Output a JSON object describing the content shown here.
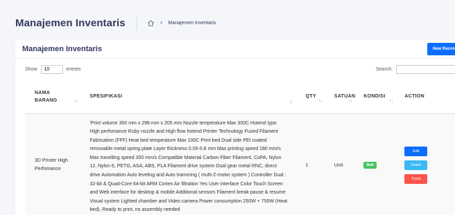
{
  "header": {
    "title": "Manajemen Inventaris",
    "breadcrumb": "Manajemen Inventaris"
  },
  "card": {
    "title": "Manajemen Inventaris",
    "new_button": "New Record"
  },
  "controls": {
    "show_label": "Show",
    "entries_value": "10",
    "entries_label": "entries",
    "search_label": "Search:"
  },
  "table": {
    "columns": [
      "NAMA BARANG",
      "SPESIFIKASI",
      "QTY",
      "SATUAN",
      "KONDISI",
      "ACTION"
    ],
    "sort_icon": "↑↓",
    "rows": [
      {
        "nama": "3D Printer High Perfomance",
        "spesifikasi": "'Print volume 300 mm x 298 mm x 205 mm Nozzle temperature Max 300C Hotend type High perfomance Ruby nozzle and High flow hotend Printer Technology Fused Filament Fabrication (FFF) Heat bed temperature Max 100C Print bed Dual side PEI coated removable metal spring plate Layer thickness 0.05-0.8 mm Max printing speed 180 mm/s Max travelling speed 350 mm/s Compatible Material Carbon Fiber Filament, CoPA, Nylon 12, Nylon 6, PETG, ASA, ABS, PLA Filament drive system Dual gear metal RNC, direct drive Automation Auto leveling and Auto tramming ( multi-Z-motor system ) Controller Dual : 32-bit & Quad-Core 64-bit ARM Cortex Air filtration Yes User interface Color Touch Screen and Web interface for desktop & mobile Additional sensors Filament break pause & resume Visual system Lighted chamber and Video camera Power consumption 250W + 750W (Heat bed), Ready to print, no assembly needed",
        "qty": "1",
        "satuan": "Unit",
        "kondisi": "Baik",
        "actions": {
          "edit": "Edit",
          "detail": "Detail",
          "trash": "Trash"
        }
      }
    ]
  },
  "colors": {
    "primary": "#0d6efd",
    "info": "#3abaf4",
    "danger": "#fc544b",
    "success": "#47c363",
    "heading": "#34395e"
  },
  "icons": {
    "home": "home-icon",
    "chevron": "chevron-right-icon",
    "sort": "sort-icon"
  }
}
